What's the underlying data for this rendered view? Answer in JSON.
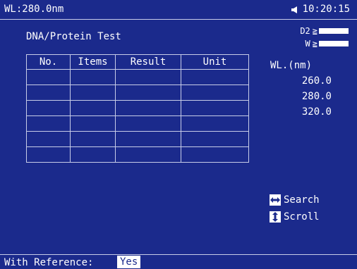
{
  "status_bar": {
    "wavelength": "WL:280.0nm",
    "time": "10:20:15"
  },
  "test": {
    "title": "DNA/Protein Test"
  },
  "lamps": [
    {
      "label": "D2",
      "mark": "≧"
    },
    {
      "label": "W",
      "mark": "≧"
    }
  ],
  "table": {
    "headers": [
      "No.",
      "Items",
      "Result",
      "Unit"
    ],
    "rows": [
      [
        "",
        "",
        "",
        ""
      ],
      [
        "",
        "",
        "",
        ""
      ],
      [
        "",
        "",
        "",
        ""
      ],
      [
        "",
        "",
        "",
        ""
      ],
      [
        "",
        "",
        "",
        ""
      ],
      [
        "",
        "",
        "",
        ""
      ]
    ]
  },
  "wavelengths": {
    "header": "WL.(nm)",
    "values": [
      "260.0",
      "280.0",
      "320.0"
    ]
  },
  "key_hints": [
    {
      "icon": "left-right-arrow-icon",
      "label": "Search"
    },
    {
      "icon": "up-down-arrow-icon",
      "label": "Scroll"
    }
  ],
  "footer": {
    "reference_label": "With Reference:",
    "reference_value": "Yes"
  }
}
